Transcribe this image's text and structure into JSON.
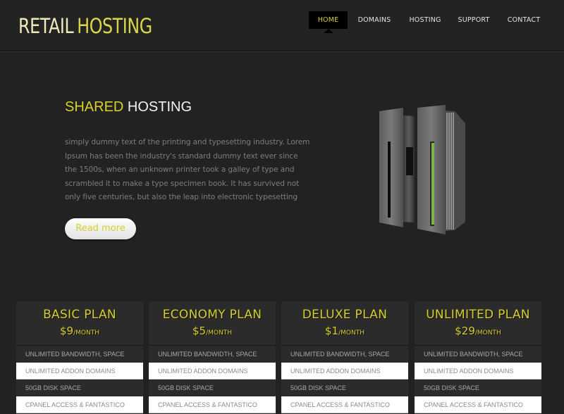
{
  "header": {
    "logo_part1": "RETAIL",
    "logo_part2": "HOSTING",
    "nav": [
      {
        "label": "HOME",
        "active": true
      },
      {
        "label": "DOMAINS",
        "active": false
      },
      {
        "label": "HOSTING",
        "active": false
      },
      {
        "label": "SUPPORT",
        "active": false
      },
      {
        "label": "CONTACT",
        "active": false
      }
    ]
  },
  "hero": {
    "title_highlight": "SHARED",
    "title_rest": "HOSTING",
    "text": "simply dummy text of the printing and typesetting industry. Lorem Ipsum has been the industry's standard dummy text ever since the 1500s, when an unknown printer took a galley of type and scrambled it to make a type specimen book. It has survived not only five centuries, but also the leap into electronic typesetting",
    "button_label": "Read more",
    "image_icon": "server-icon"
  },
  "plans": [
    {
      "name": "BASIC PLAN",
      "price": "$9",
      "period": "/MONTH",
      "features": [
        "UNLIMITED BANDWIDTH, SPACE",
        "UNLIMITED ADDON DOMAINS",
        "50GB DISK SPACE",
        "CPANEL ACCESS & FANTASTICO"
      ]
    },
    {
      "name": "ECONOMY PLAN",
      "price": "$5",
      "period": "/MONTH",
      "features": [
        "UNLIMITED BANDWIDTH, SPACE",
        "UNLIMITED ADDON DOMAINS",
        "50GB DISK SPACE",
        "CPANEL ACCESS & FANTASTICO"
      ]
    },
    {
      "name": "DELUXE PLAN",
      "price": "$1",
      "period": "/MONTH",
      "features": [
        "UNLIMITED BANDWIDTH, SPACE",
        "UNLIMITED ADDON DOMAINS",
        "50GB DISK SPACE",
        "CPANEL ACCESS & FANTASTICO"
      ]
    },
    {
      "name": "UNLIMITED PLAN",
      "price": "$29",
      "period": "/MONTH",
      "features": [
        "UNLIMITED BANDWIDTH, SPACE",
        "UNLIMITED ADDON DOMAINS",
        "50GB DISK SPACE",
        "CPANEL ACCESS & FANTASTICO"
      ]
    }
  ],
  "colors": {
    "accent": "#d6ce2e",
    "background": "#212221",
    "server_led": "#7ab648"
  }
}
